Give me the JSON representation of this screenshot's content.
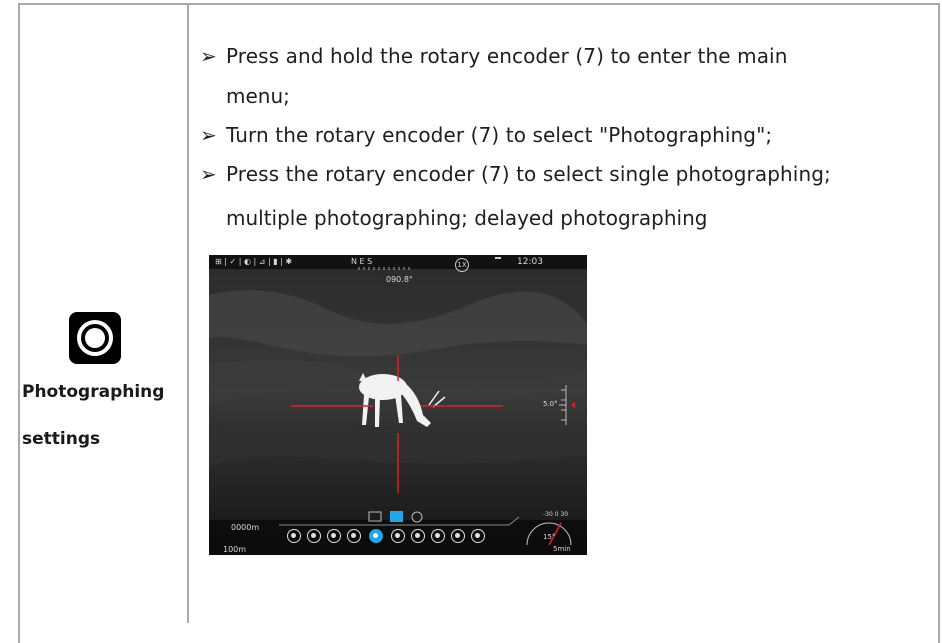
{
  "left_cell": {
    "icon": "camera-icon",
    "label_line1": "Photographing",
    "label_line2": "settings"
  },
  "instructions": [
    "Press and hold the rotary encoder (7) to enter the main",
    "menu;",
    "Turn the rotary encoder (7) to select \"Photographing\";",
    "Press the rotary encoder (7) to select single photographing;",
    "multiple photographing; delayed photographing"
  ],
  "bullet_symbol": "➢",
  "device_screen": {
    "compass": "N       E       S",
    "heading": "090.8°",
    "zoom": "1X",
    "battery": "",
    "time": "12:03",
    "range": "0000m",
    "distance": "100m",
    "tilt": "5.0°",
    "angle": "15°",
    "scale": "-30   0   30",
    "timer": "5min",
    "accent_color": "#1fa7e8",
    "reticle_color": "#e02020"
  }
}
